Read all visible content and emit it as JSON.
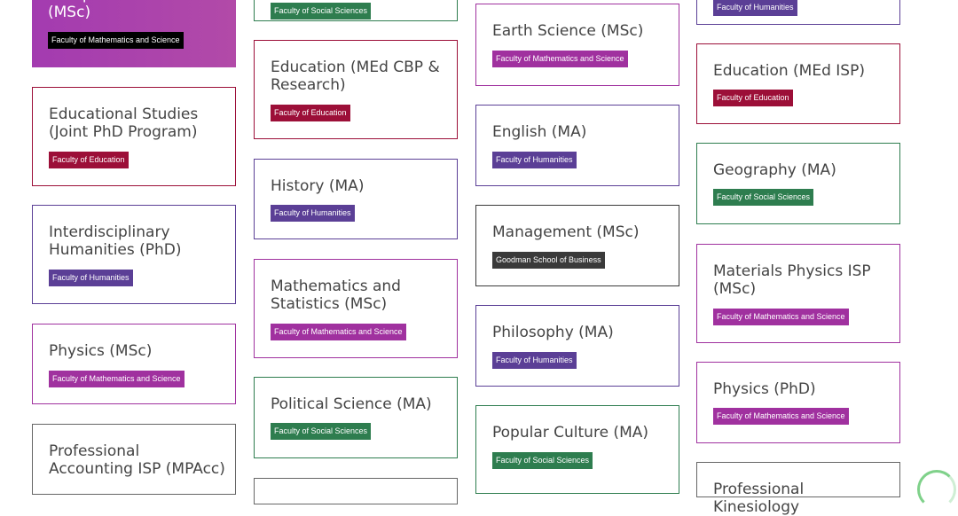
{
  "faculty_colors": {
    "Faculty of Mathematics and Science": "#a0319f",
    "Faculty of Education": "#9c0f38",
    "Faculty of Humanities": "#5b3f96",
    "Faculty of Social Sciences": "#2e7d4f",
    "Goodman School of Business": "#3a3a3a",
    "Faculty of Mathematics and Science (selected)": "#000000"
  },
  "columns": [
    {
      "cards": [
        {
          "title": "Computer Science (MSc)",
          "faculty": "Faculty of Mathematics and Science",
          "selected": true
        },
        {
          "title": "Educational Studies (Joint PhD Program)",
          "faculty": "Faculty of Education"
        },
        {
          "title": "Interdisciplinary Humanities (PhD)",
          "faculty": "Faculty of Humanities"
        },
        {
          "title": "Physics (MSc)",
          "faculty": "Faculty of Mathematics and Science"
        },
        {
          "title": "Professional Accounting ISP (MPAcc)",
          "faculty": ""
        }
      ]
    },
    {
      "cards": [
        {
          "title": "",
          "faculty": "Faculty of Social Sciences"
        },
        {
          "title": "Education (MEd CBP & Research)",
          "faculty": "Faculty of Education"
        },
        {
          "title": "History (MA)",
          "faculty": "Faculty of Humanities"
        },
        {
          "title": "Mathematics and Statistics (MSc)",
          "faculty": "Faculty of Mathematics and Science"
        },
        {
          "title": "Political Science (MA)",
          "faculty": "Faculty of Social Sciences"
        },
        {
          "title": "",
          "faculty": ""
        }
      ]
    },
    {
      "cards": [
        {
          "title": "Earth Science (MSc)",
          "faculty": "Faculty of Mathematics and Science"
        },
        {
          "title": "English (MA)",
          "faculty": "Faculty of Humanities"
        },
        {
          "title": "Management (MSc)",
          "faculty": "Goodman School of Business"
        },
        {
          "title": "Philosophy (MA)",
          "faculty": "Faculty of Humanities"
        },
        {
          "title": "Popular Culture (MA)",
          "faculty": "Faculty of Social Sciences"
        }
      ]
    },
    {
      "cards": [
        {
          "title": "",
          "faculty": "Faculty of Humanities"
        },
        {
          "title": "Education (MEd ISP)",
          "faculty": "Faculty of Education"
        },
        {
          "title": "Geography (MA)",
          "faculty": "Faculty of Social Sciences"
        },
        {
          "title": "Materials Physics ISP (MSc)",
          "faculty": "Faculty of Mathematics and Science"
        },
        {
          "title": "Physics (PhD)",
          "faculty": "Faculty of Mathematics and Science"
        },
        {
          "title": "Professional Kinesiology",
          "faculty": ""
        }
      ]
    }
  ]
}
